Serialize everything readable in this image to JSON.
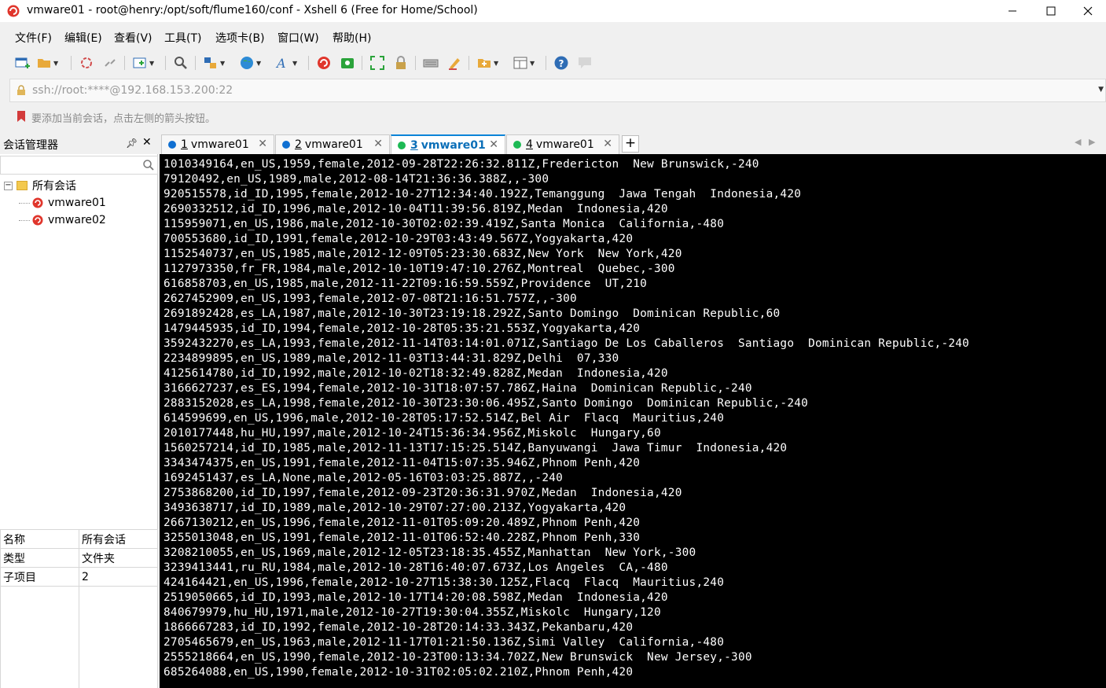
{
  "window": {
    "title": "vmware01 - root@henry:/opt/soft/flume160/conf - Xshell 6 (Free for Home/School)"
  },
  "menu": [
    "文件(F)",
    "编辑(E)",
    "查看(V)",
    "工具(T)",
    "选项卡(B)",
    "窗口(W)",
    "帮助(H)"
  ],
  "address": {
    "value": "ssh://root:****@192.168.153.200:22"
  },
  "hint": "要添加当前会话，点击左侧的箭头按钮。",
  "session_manager": {
    "title": "会话管理器",
    "search_value": "",
    "tree": {
      "root": "所有会话",
      "children": [
        "vmware01",
        "vmware02"
      ]
    },
    "properties": [
      {
        "key": "名称",
        "value": "所有会话"
      },
      {
        "key": "类型",
        "value": "文件夹"
      },
      {
        "key": "子项目",
        "value": "2"
      }
    ]
  },
  "tabs": [
    {
      "num": "1",
      "label": "vmware01",
      "status": "warning"
    },
    {
      "num": "2",
      "label": "vmware01",
      "status": "warning"
    },
    {
      "num": "3",
      "label": "vmware01",
      "status": "connected",
      "active": true
    },
    {
      "num": "4",
      "label": "vmware01",
      "status": "connected"
    }
  ],
  "colors": {
    "accent": "#0b84d8",
    "warning": "#0f6fd1",
    "connected": "#1db954",
    "terminal_bg": "#000000",
    "terminal_fg": "#ffffff"
  },
  "terminal_lines": [
    "1010349164,en_US,1959,female,2012-09-28T22:26:32.811Z,Fredericton  New Brunswick,-240",
    "79120492,en_US,1989,male,2012-08-14T21:36:36.388Z,,-300",
    "920515578,id_ID,1995,female,2012-10-27T12:34:40.192Z,Temanggung  Jawa Tengah  Indonesia,420",
    "2690332512,id_ID,1996,male,2012-10-04T11:39:56.819Z,Medan  Indonesia,420",
    "115959071,en_US,1986,male,2012-10-30T02:02:39.419Z,Santa Monica  California,-480",
    "700553680,id_ID,1991,female,2012-10-29T03:43:49.567Z,Yogyakarta,420",
    "1152540737,en_US,1985,male,2012-12-09T05:23:30.683Z,New York  New York,420",
    "1127973350,fr_FR,1984,male,2012-10-10T19:47:10.276Z,Montreal  Quebec,-300",
    "616858703,en_US,1985,male,2012-11-22T09:16:59.559Z,Providence  UT,210",
    "2627452909,en_US,1993,female,2012-07-08T21:16:51.757Z,,-300",
    "2691892428,es_LA,1987,male,2012-10-30T23:19:18.292Z,Santo Domingo  Dominican Republic,60",
    "1479445935,id_ID,1994,female,2012-10-28T05:35:21.553Z,Yogyakarta,420",
    "3592432270,es_LA,1993,female,2012-11-14T03:14:01.071Z,Santiago De Los Caballeros  Santiago  Dominican Republic,-240",
    "2234899895,en_US,1989,male,2012-11-03T13:44:31.829Z,Delhi  07,330",
    "4125614780,id_ID,1992,male,2012-10-02T18:32:49.828Z,Medan  Indonesia,420",
    "3166627237,es_ES,1994,female,2012-10-31T18:07:57.786Z,Haina  Dominican Republic,-240",
    "2883152028,es_LA,1998,female,2012-10-30T23:30:06.495Z,Santo Domingo  Dominican Republic,-240",
    "614599699,en_US,1996,male,2012-10-28T05:17:52.514Z,Bel Air  Flacq  Mauritius,240",
    "2010177448,hu_HU,1997,male,2012-10-24T15:36:34.956Z,Miskolc  Hungary,60",
    "1560257214,id_ID,1985,male,2012-11-13T17:15:25.514Z,Banyuwangi  Jawa Timur  Indonesia,420",
    "3343474375,en_US,1991,female,2012-11-04T15:07:35.946Z,Phnom Penh,420",
    "1692451437,es_LA,None,male,2012-05-16T03:03:25.887Z,,-240",
    "2753868200,id_ID,1997,female,2012-09-23T20:36:31.970Z,Medan  Indonesia,420",
    "3493638717,id_ID,1989,male,2012-10-29T07:27:00.213Z,Yogyakarta,420",
    "2667130212,en_US,1996,female,2012-11-01T05:09:20.489Z,Phnom Penh,420",
    "3255013048,en_US,1991,female,2012-11-01T06:52:40.228Z,Phnom Penh,330",
    "3208210055,en_US,1969,male,2012-12-05T23:18:35.455Z,Manhattan  New York,-300",
    "3239413441,ru_RU,1984,male,2012-10-28T16:40:07.673Z,Los Angeles  CA,-480",
    "424164421,en_US,1996,female,2012-10-27T15:38:30.125Z,Flacq  Flacq  Mauritius,240",
    "2519050665,id_ID,1993,male,2012-10-17T14:20:08.598Z,Medan  Indonesia,420",
    "840679979,hu_HU,1971,male,2012-10-27T19:30:04.355Z,Miskolc  Hungary,120",
    "1866667283,id_ID,1992,female,2012-10-28T20:14:33.343Z,Pekanbaru,420",
    "2705465679,en_US,1963,male,2012-11-17T01:21:50.136Z,Simi Valley  California,-480",
    "2555218664,en_US,1990,female,2012-10-23T00:13:34.702Z,New Brunswick  New Jersey,-300",
    "685264088,en_US,1990,female,2012-10-31T02:05:02.210Z,Phnom Penh,420"
  ]
}
